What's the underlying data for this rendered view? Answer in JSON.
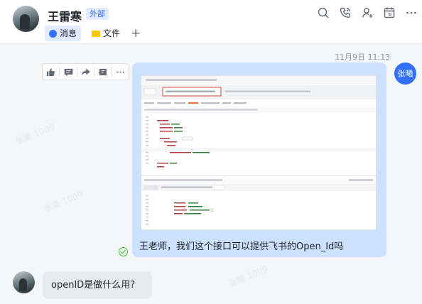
{
  "header": {
    "contact_name": "王雷寒",
    "badge": "外部",
    "tabs": [
      {
        "label": "消息",
        "icon": "chat-bubble-icon",
        "active": true
      },
      {
        "label": "文件",
        "icon": "folder-icon",
        "active": false
      }
    ],
    "add_tab": "+",
    "actions": [
      "search-chat-icon",
      "call-icon",
      "add-member-icon",
      "calendar-icon",
      "more-icon"
    ]
  },
  "messages": [
    {
      "timestamp": "11月9日 11:13",
      "sender_avatar_text": "张曦",
      "direction": "outgoing",
      "attachment": "embedded-screenshot",
      "text": "王老师，我们这个接口可以提供飞书的Open_Id吗",
      "read": true
    },
    {
      "direction": "incoming",
      "text": "openID是做什么用?"
    }
  ],
  "toolbar_actions": [
    "thumbs-up-icon",
    "comment-icon",
    "forward-icon",
    "reply-icon",
    "more-icon"
  ],
  "watermark": "张曦 1009",
  "colors": {
    "accent": "#3370ff",
    "outgoing_bubble": "#cce0ff",
    "incoming_bubble": "#e8e9eb",
    "read_check": "#34c724"
  }
}
